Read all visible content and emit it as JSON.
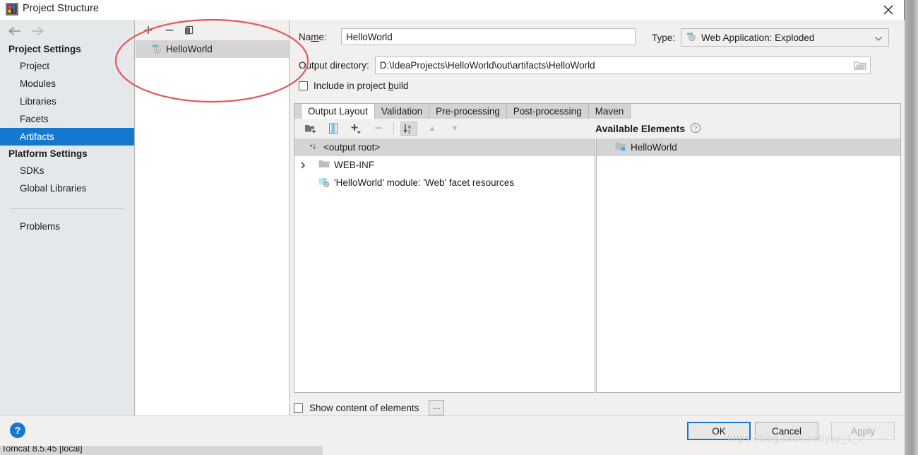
{
  "window": {
    "title": "Project Structure",
    "app_icon": "intellij-idea-icon",
    "close_label": "×"
  },
  "nav": {
    "back_icon": "arrow-left-icon",
    "forward_icon": "arrow-right-icon",
    "groups": [
      {
        "title": "Project Settings",
        "items": [
          {
            "label": "Project",
            "selected": false
          },
          {
            "label": "Modules",
            "selected": false
          },
          {
            "label": "Libraries",
            "selected": false
          },
          {
            "label": "Facets",
            "selected": false
          },
          {
            "label": "Artifacts",
            "selected": true
          }
        ]
      },
      {
        "title": "Platform Settings",
        "items": [
          {
            "label": "SDKs",
            "selected": false
          },
          {
            "label": "Global Libraries",
            "selected": false
          }
        ]
      }
    ],
    "problems_label": "Problems"
  },
  "artifacts_panel": {
    "toolbar": {
      "add_label": "+",
      "remove_label": "−",
      "copy_icon": "copy-icon"
    },
    "items": [
      {
        "label": "HelloWorld",
        "icon": "artifact-icon",
        "selected": true
      }
    ]
  },
  "details": {
    "name_label": "Name:",
    "name_mnemonic": "m",
    "name_value": "HelloWorld",
    "name_placeholder": "",
    "type_label": "Type:",
    "type_value": "Web Application: Exploded",
    "type_icon": "artifact-icon",
    "type_caret_icon": "chevron-down-icon",
    "output_dir_label": "Output directory:",
    "output_dir_value": "D:\\IdeaProjects\\HelloWorld\\out\\artifacts\\HelloWorld",
    "output_dir_placeholder": "",
    "browse_icon": "folder-icon",
    "include_label": "Include in project build",
    "include_mnemonic": "b",
    "include_checked": false
  },
  "tabs": [
    {
      "label": "Output Layout",
      "active": true
    },
    {
      "label": "Validation",
      "active": false
    },
    {
      "label": "Pre-processing",
      "active": false
    },
    {
      "label": "Post-processing",
      "active": false
    },
    {
      "label": "Maven",
      "active": false
    }
  ],
  "output_layout": {
    "toolbar": [
      {
        "name": "new-directory-icon",
        "label": "",
        "enabled": true
      },
      {
        "name": "archive-icon",
        "label": "",
        "enabled": true
      },
      {
        "name": "add-icon",
        "label": "+",
        "enabled": true
      },
      {
        "name": "remove-icon",
        "label": "−",
        "enabled": false
      },
      {
        "name": "sort-alphabetically-icon",
        "label": "",
        "enabled": true,
        "active": true
      },
      {
        "name": "move-up-icon",
        "label": "▲",
        "enabled": false
      },
      {
        "name": "move-down-icon",
        "label": "▼",
        "enabled": false
      }
    ],
    "tree": [
      {
        "label": "<output root>",
        "icon": "output-root-icon",
        "depth": 0,
        "selected": true,
        "expandable": false
      },
      {
        "label": "WEB-INF",
        "icon": "folder-icon",
        "depth": 0,
        "selected": false,
        "expandable": true
      },
      {
        "label": "'HelloWorld' module: 'Web' facet resources",
        "icon": "facet-resources-icon",
        "depth": 1,
        "selected": false,
        "expandable": false
      }
    ]
  },
  "available_elements": {
    "title": "Available Elements",
    "help_icon": "help-circle-icon",
    "items": [
      {
        "label": "HelloWorld",
        "icon": "module-folder-icon",
        "selected": true
      }
    ]
  },
  "bottom_options": {
    "show_content_label": "Show content of elements",
    "show_content_checked": false,
    "ellipsis_label": "..."
  },
  "footer": {
    "help_label": "?",
    "ok_label": "OK",
    "cancel_label": "Cancel",
    "apply_label": "Apply",
    "apply_enabled": false,
    "ok_focused": true
  },
  "annotation": {
    "shape": "ellipse",
    "color": "#e2575c"
  },
  "ide_background": {
    "bottom_label": "Tomcat 8.5.45 [local]"
  },
  "watermark": {
    "text": "https://blog.csdn.net/ysy_1_2"
  }
}
